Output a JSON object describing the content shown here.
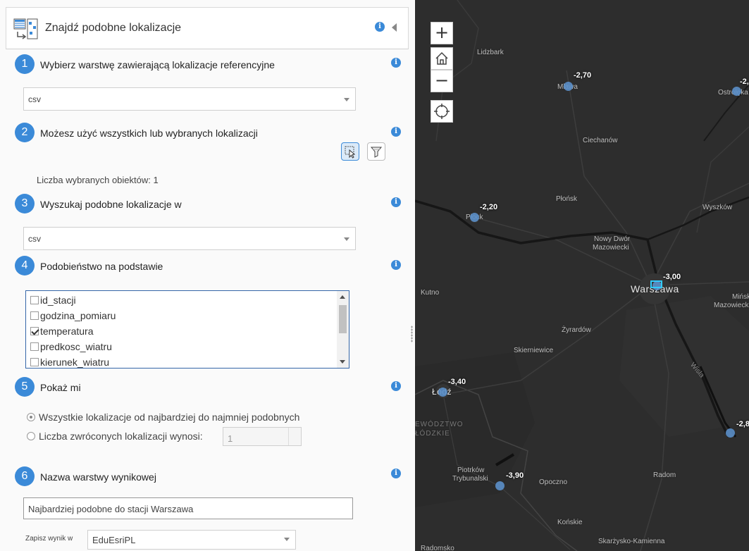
{
  "panel": {
    "title": "Znajdź podobne lokalizacje"
  },
  "steps": [
    {
      "num": "1",
      "title": "Wybierz warstwę zawierającą lokalizacje referencyjne"
    },
    {
      "num": "2",
      "title": "Możesz użyć wszystkich lub wybranych lokalizacji"
    },
    {
      "num": "3",
      "title": "Wyszukaj podobne lokalizacje w"
    },
    {
      "num": "4",
      "title": "Podobieństwo na podstawie"
    },
    {
      "num": "5",
      "title": "Pokaż mi"
    },
    {
      "num": "6",
      "title": "Nazwa warstwy wynikowej"
    }
  ],
  "step1": {
    "layer_value": "csv"
  },
  "step2": {
    "selected_count_text": "Liczba wybranych obiektów: 1"
  },
  "step3": {
    "layer_value": "csv"
  },
  "step4": {
    "fields": [
      {
        "label": "id_stacji",
        "checked": false
      },
      {
        "label": "godzina_pomiaru",
        "checked": false
      },
      {
        "label": "temperatura",
        "checked": true
      },
      {
        "label": "predkosc_wiatru",
        "checked": false
      },
      {
        "label": "kierunek_wiatru",
        "checked": false
      }
    ]
  },
  "step5": {
    "option_all": "Wszystkie lokalizacje od najbardziej do najmniej podobnych",
    "option_count": "Liczba zwróconych lokalizacji wynosi:",
    "count_value": "1"
  },
  "step6": {
    "result_name": "Najbardziej podobne do stacji Warszawa",
    "save_label": "Zapisz wynik w",
    "save_value": "EduEsriPL"
  },
  "map": {
    "zoom_in": "+",
    "zoom_out": "−",
    "places": {
      "lidzbark": "Lidzbark",
      "mlawa": "Mława",
      "ostroleka": "Ostrołęka",
      "ciechanow": "Ciechanów",
      "plonsk": "Płońsk",
      "wyszkow": "Wyszków",
      "plock": "Płock",
      "nowy_dwor_1": "Nowy Dwór",
      "nowy_dwor_2": "Mazowiecki",
      "kutno": "Kutno",
      "warszawa": "Warszawa",
      "minsk_1": "Mińsk",
      "minsk_2": "Mazowiecki",
      "zyrardow": "Żyrardów",
      "skierniewice": "Skierniewice",
      "lodz": "Łódź",
      "region_1": "EWÓDZTWO",
      "region_2": "ŁÓDZKIE",
      "wisla": "Wisła",
      "piotrkow_1": "Piotrków",
      "piotrkow_2": "Trybunalski",
      "opoczno": "Opoczno",
      "radom": "Radom",
      "konskie": "Końskie",
      "skarzysko": "Skarżysko-Kamienna",
      "radomsko": "Radomsko"
    },
    "values": {
      "mlawa": "-2,70",
      "ostroleka": "-2,",
      "plock": "-2,20",
      "warszawa": "-3,00",
      "lodz": "-3,40",
      "piotrkow": "-3,90",
      "radom_east": "-2,8"
    }
  },
  "colors": {
    "accent": "#3b8ad8",
    "map_bg": "#2d2d2d",
    "point": "#5b8fc9",
    "selection": "#33ccff"
  }
}
